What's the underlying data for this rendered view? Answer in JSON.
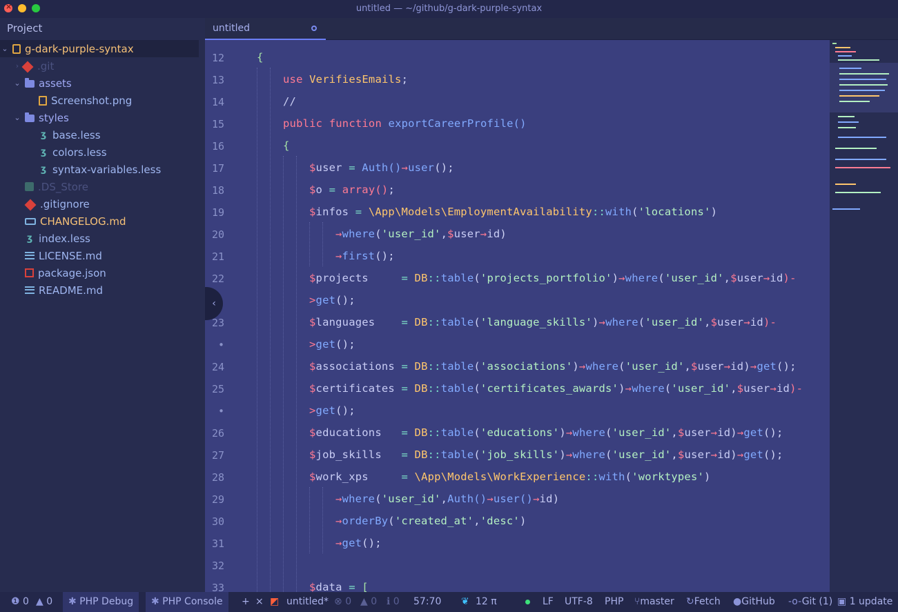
{
  "window": {
    "title": "untitled — ~/github/g-dark-purple-syntax"
  },
  "sidebar": {
    "header": "Project",
    "root": "g-dark-purple-syntax",
    "items": [
      {
        "label": ".git",
        "icon": "git-icon"
      },
      {
        "label": "assets",
        "icon": "folder-icon"
      },
      {
        "label": "Screenshot.png",
        "icon": "image-icon"
      },
      {
        "label": "styles",
        "icon": "folder-icon"
      },
      {
        "label": "base.less",
        "icon": "css-icon"
      },
      {
        "label": "colors.less",
        "icon": "css-icon"
      },
      {
        "label": "syntax-variables.less",
        "icon": "css-icon"
      },
      {
        "label": ".DS_Store",
        "icon": "ds-store-icon"
      },
      {
        "label": ".gitignore",
        "icon": "git-icon"
      },
      {
        "label": "CHANGELOG.md",
        "icon": "markdown-icon"
      },
      {
        "label": "index.less",
        "icon": "css-icon"
      },
      {
        "label": "LICENSE.md",
        "icon": "text-icon"
      },
      {
        "label": "package.json",
        "icon": "npm-icon"
      },
      {
        "label": "README.md",
        "icon": "text-icon"
      }
    ]
  },
  "tab": {
    "label": "untitled"
  },
  "editor": {
    "gutter": [
      "12",
      "13",
      "14",
      "15",
      "16",
      "17",
      "18",
      "19",
      "20",
      "21",
      "22",
      "",
      "23",
      "•",
      "24",
      "25",
      "•",
      "26",
      "27",
      "28",
      "29",
      "30",
      "31",
      "32",
      "33"
    ],
    "lines": {
      "l12": "{",
      "l13a": "use ",
      "l13b": "VerifiesEmails",
      "l13c": ";",
      "l14": "//",
      "l15a": "public ",
      "l15b": "function ",
      "l15c": "exportCareerProfile",
      "l15d": "()",
      "l16": "{",
      "l17a": "$",
      "l17b": "user",
      "l17c": " = ",
      "l17d": "Auth",
      "l17e": "()",
      "l17f": "→",
      "l17g": "user",
      "l17h": "();",
      "l18a": "$",
      "l18b": "o",
      "l18c": " = ",
      "l18d": "array",
      "l18e": "()",
      "l18f": ";",
      "l19a": "$",
      "l19b": "infos",
      "l19c": " = ",
      "l19d": "\\App",
      "l19e": "\\Models",
      "l19f": "\\EmploymentAvailability",
      "l19g": "::",
      "l19h": "with",
      "l19i": "(",
      "l19j": "'locations'",
      "l19k": ")",
      "l20a": "→",
      "l20b": "where",
      "l20c": "(",
      "l20d": "'user_id'",
      "l20e": ",",
      "l20f": "$",
      "l20g": "user",
      "l20h": "→",
      "l20i": "id",
      "l20j": ")",
      "l21a": "→",
      "l21b": "first",
      "l21c": "();",
      "l22a": "$",
      "l22b": "projects     ",
      "l22c": "= ",
      "l22d": "DB",
      "l22e": "::",
      "l22f": "table",
      "l22g": "(",
      "l22h": "'projects_portfolio'",
      "l22i": ")",
      "l22j": "→",
      "l22k": "where",
      "l22l": "(",
      "l22m": "'user_id'",
      "l22n": ",",
      "l22o": "$",
      "l22p": "user",
      "l22q": "→",
      "l22r": "id",
      "l22s": ")-",
      "l22w1": ">",
      "l22w2": "get",
      "l22w3": "();",
      "l23a": "$",
      "l23b": "languages    ",
      "l23c": "= ",
      "l23d": "DB",
      "l23e": "::",
      "l23f": "table",
      "l23g": "(",
      "l23h": "'language_skills'",
      "l23i": ")",
      "l23j": "→",
      "l23k": "where",
      "l23l": "(",
      "l23m": "'user_id'",
      "l23n": ",",
      "l23o": "$",
      "l23p": "user",
      "l23q": "→",
      "l23r": "id",
      "l23s": ")-",
      "l23w1": ">",
      "l23w2": "get",
      "l23w3": "();",
      "l24a": "$",
      "l24b": "associations ",
      "l24c": "= ",
      "l24d": "DB",
      "l24e": "::",
      "l24f": "table",
      "l24g": "(",
      "l24h": "'associations'",
      "l24i": ")",
      "l24j": "→",
      "l24k": "where",
      "l24l": "(",
      "l24m": "'user_id'",
      "l24n": ",",
      "l24o": "$",
      "l24p": "user",
      "l24q": "→",
      "l24r": "id",
      "l24s": ")",
      "l24t": "→",
      "l24u": "get",
      "l24v": "();",
      "l25a": "$",
      "l25b": "certificates ",
      "l25c": "= ",
      "l25d": "DB",
      "l25e": "::",
      "l25f": "table",
      "l25g": "(",
      "l25h": "'certificates_awards'",
      "l25i": ")",
      "l25j": "→",
      "l25k": "where",
      "l25l": "(",
      "l25m": "'user_id'",
      "l25n": ",",
      "l25o": "$",
      "l25p": "user",
      "l25q": "→",
      "l25r": "id",
      "l25s": ")-",
      "l25w1": ">",
      "l25w2": "get",
      "l25w3": "();",
      "l26a": "$",
      "l26b": "educations   ",
      "l26c": "= ",
      "l26d": "DB",
      "l26e": "::",
      "l26f": "table",
      "l26g": "(",
      "l26h": "'educations'",
      "l26i": ")",
      "l26j": "→",
      "l26k": "where",
      "l26l": "(",
      "l26m": "'user_id'",
      "l26n": ",",
      "l26o": "$",
      "l26p": "user",
      "l26q": "→",
      "l26r": "id",
      "l26s": ")",
      "l26t": "→",
      "l26u": "get",
      "l26v": "();",
      "l27a": "$",
      "l27b": "job_skills   ",
      "l27c": "= ",
      "l27d": "DB",
      "l27e": "::",
      "l27f": "table",
      "l27g": "(",
      "l27h": "'job_skills'",
      "l27i": ")",
      "l27j": "→",
      "l27k": "where",
      "l27l": "(",
      "l27m": "'user_id'",
      "l27n": ",",
      "l27o": "$",
      "l27p": "user",
      "l27q": "→",
      "l27r": "id",
      "l27s": ")",
      "l27t": "→",
      "l27u": "get",
      "l27v": "();",
      "l28a": "$",
      "l28b": "work_xps     ",
      "l28c": "= ",
      "l28d": "\\App",
      "l28e": "\\Models",
      "l28f": "\\WorkExperience",
      "l28g": "::",
      "l28h": "with",
      "l28i": "(",
      "l28j": "'worktypes'",
      "l28k": ")",
      "l29a": "→",
      "l29b": "where",
      "l29c": "(",
      "l29d": "'user_id'",
      "l29e": ",",
      "l29f": "Auth",
      "l29g": "()",
      "l29h": "→",
      "l29i": "user",
      "l29j": "()",
      "l29k": "→",
      "l29l": "id",
      "l29m": ")",
      "l30a": "→",
      "l30b": "orderBy",
      "l30c": "(",
      "l30d": "'created_at'",
      "l30e": ",",
      "l30f": "'desc'",
      "l30g": ")",
      "l31a": "→",
      "l31b": "get",
      "l31c": "();",
      "l33a": "$",
      "l33b": "data",
      "l33c": " = ",
      "l33d": "["
    }
  },
  "statusbar": {
    "errors": "0",
    "warnings": "0",
    "php_debug": "PHP Debug",
    "php_console": "PHP Console",
    "file": "untitled*",
    "lint_errors": "0",
    "lint_warnings": "0",
    "lint_infos": "0",
    "cursor": "57:70",
    "paw_count": "12 π",
    "line_ending": "LF",
    "encoding": "UTF-8",
    "grammar": "PHP",
    "branch": "master",
    "fetch": "Fetch",
    "github": "GitHub",
    "git": "Git (1)",
    "updates": "1 update"
  },
  "colors": {
    "editor_bg": "#3a3f7e",
    "sidebar_bg": "#272c4f",
    "keyword": "#ff7b93",
    "class": "#ffc66d",
    "function": "#82aaff",
    "string": "#b4f0c2",
    "accent": "#6b7ef5"
  }
}
